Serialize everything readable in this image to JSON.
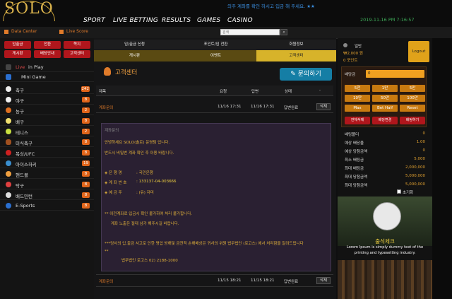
{
  "header": {
    "logo": "SOLO",
    "notice": "의주 계좌를 확인 하시고 입금 해 주세요. ★★",
    "datetime": "2019-11-16 PM 7:16:57",
    "nav": [
      "SPORT",
      "LIVE BETTING",
      "RESULTS",
      "GAMES",
      "CASINO"
    ]
  },
  "subbar": {
    "data_center": "Data Center",
    "live_score": "Live Score",
    "search_placeholder": "검색",
    "search_icon": "search-icon"
  },
  "left_buttons": [
    "입출금",
    "전환",
    "쪽지",
    "게시판",
    "배당안내",
    "고객센터"
  ],
  "sidebar": {
    "live": "Live",
    "in_play": "in Play",
    "mini_game": "Mini Game",
    "sports": [
      {
        "label": "축구",
        "count": "242"
      },
      {
        "label": "야구",
        "count": "8"
      },
      {
        "label": "농구",
        "count": "2"
      },
      {
        "label": "배구",
        "count": "8"
      },
      {
        "label": "테니스",
        "count": "2"
      },
      {
        "label": "미식축구",
        "count": "8"
      },
      {
        "label": "복싱/UFC",
        "count": "8"
      },
      {
        "label": "아이스하키",
        "count": "19"
      },
      {
        "label": "핸드볼",
        "count": "8"
      },
      {
        "label": "탁구",
        "count": "8"
      },
      {
        "label": "배드민턴",
        "count": "8"
      },
      {
        "label": "E-Sports",
        "count": "8"
      }
    ]
  },
  "tabs_row1": [
    "입/출금 신청",
    "포인트/입 전환",
    "회원정보"
  ],
  "tabs_row2": [
    "게시판",
    "이벤트",
    "고객센터"
  ],
  "content": {
    "title": "고객센터",
    "inquiry_button": "문의하기",
    "columns": [
      "제목",
      "요청",
      "답변",
      "상태",
      "-"
    ],
    "rows": [
      {
        "title": "계좌문의",
        "requested": "11/16 17:31",
        "answered": "11/16 17:31",
        "status": "답변완료",
        "action": "삭제"
      },
      {
        "title": "계좌문의",
        "requested": "11/15 18:21",
        "answered": "11/15 18:21",
        "status": "답변완료",
        "action": "삭제"
      }
    ],
    "panel": {
      "heading": "계좌문의",
      "line1": "안녕하세요 SOLO(솔로) 운영팀 입니다.",
      "line2": "반드시 비밀번 계좌 확인 후 이용 바랍니다.",
      "bank_label": "◈ 은 행 명",
      "bank_value": ": 국민은행",
      "account_label": "◈ 계 좌 번 호",
      "account_value": ": 133137-04-003666",
      "holder_label": "◈ 예 금 주",
      "holder_value": ": (유) 자미",
      "warn1": "** 이전계좌로 입금시 확인 불가하여 처리 불가합니다.",
      "warn2": "계좌 노출은 절대 삼가 해주시길 바랍니다.",
      "law1": "***당사의 입.출금 서고로 인한 명업 방해및 금전적 손해배상은 귀사의 위원 법무법인 (로고스) 에서 처리함을 알려드립니다",
      "law2": "**",
      "law3": "법무법인 로고스 02) 2188-1000"
    }
  },
  "right": {
    "level": "일반",
    "balance": "₩2,000 원",
    "point": "0 포인트",
    "logout": "Logout",
    "bet_label": "배당금",
    "bet_value": "0",
    "chips": [
      "5천",
      "1만",
      "5만",
      "10만",
      "50만",
      "100만",
      "Max",
      "Bet Half",
      "Reset"
    ],
    "actions": [
      "전체삭제",
      "배당변경",
      "배팅하기"
    ],
    "info": [
      {
        "label": "배팅폴더",
        "value": "0"
      },
      {
        "label": "예상 배당율",
        "value": "1.00"
      },
      {
        "label": "예상 당첨금액",
        "value": "0"
      },
      {
        "label": "최소 배팅금",
        "value": "5,000"
      },
      {
        "label": "최대 배팅금",
        "value": "2,000,000"
      },
      {
        "label": "최대 당첨금액",
        "value": "5,000,000"
      },
      {
        "label": "최대 당첨금액",
        "value": "5,000,000"
      }
    ],
    "reset_label": "초기화",
    "banner_title": "출석체크",
    "banner_text": "Lorem Ipsum is simply dummy text of the printing and typesetting industry."
  },
  "colors": {
    "accent": "#e0a21a",
    "red": "#b0161c",
    "blue": "#157ea5"
  }
}
